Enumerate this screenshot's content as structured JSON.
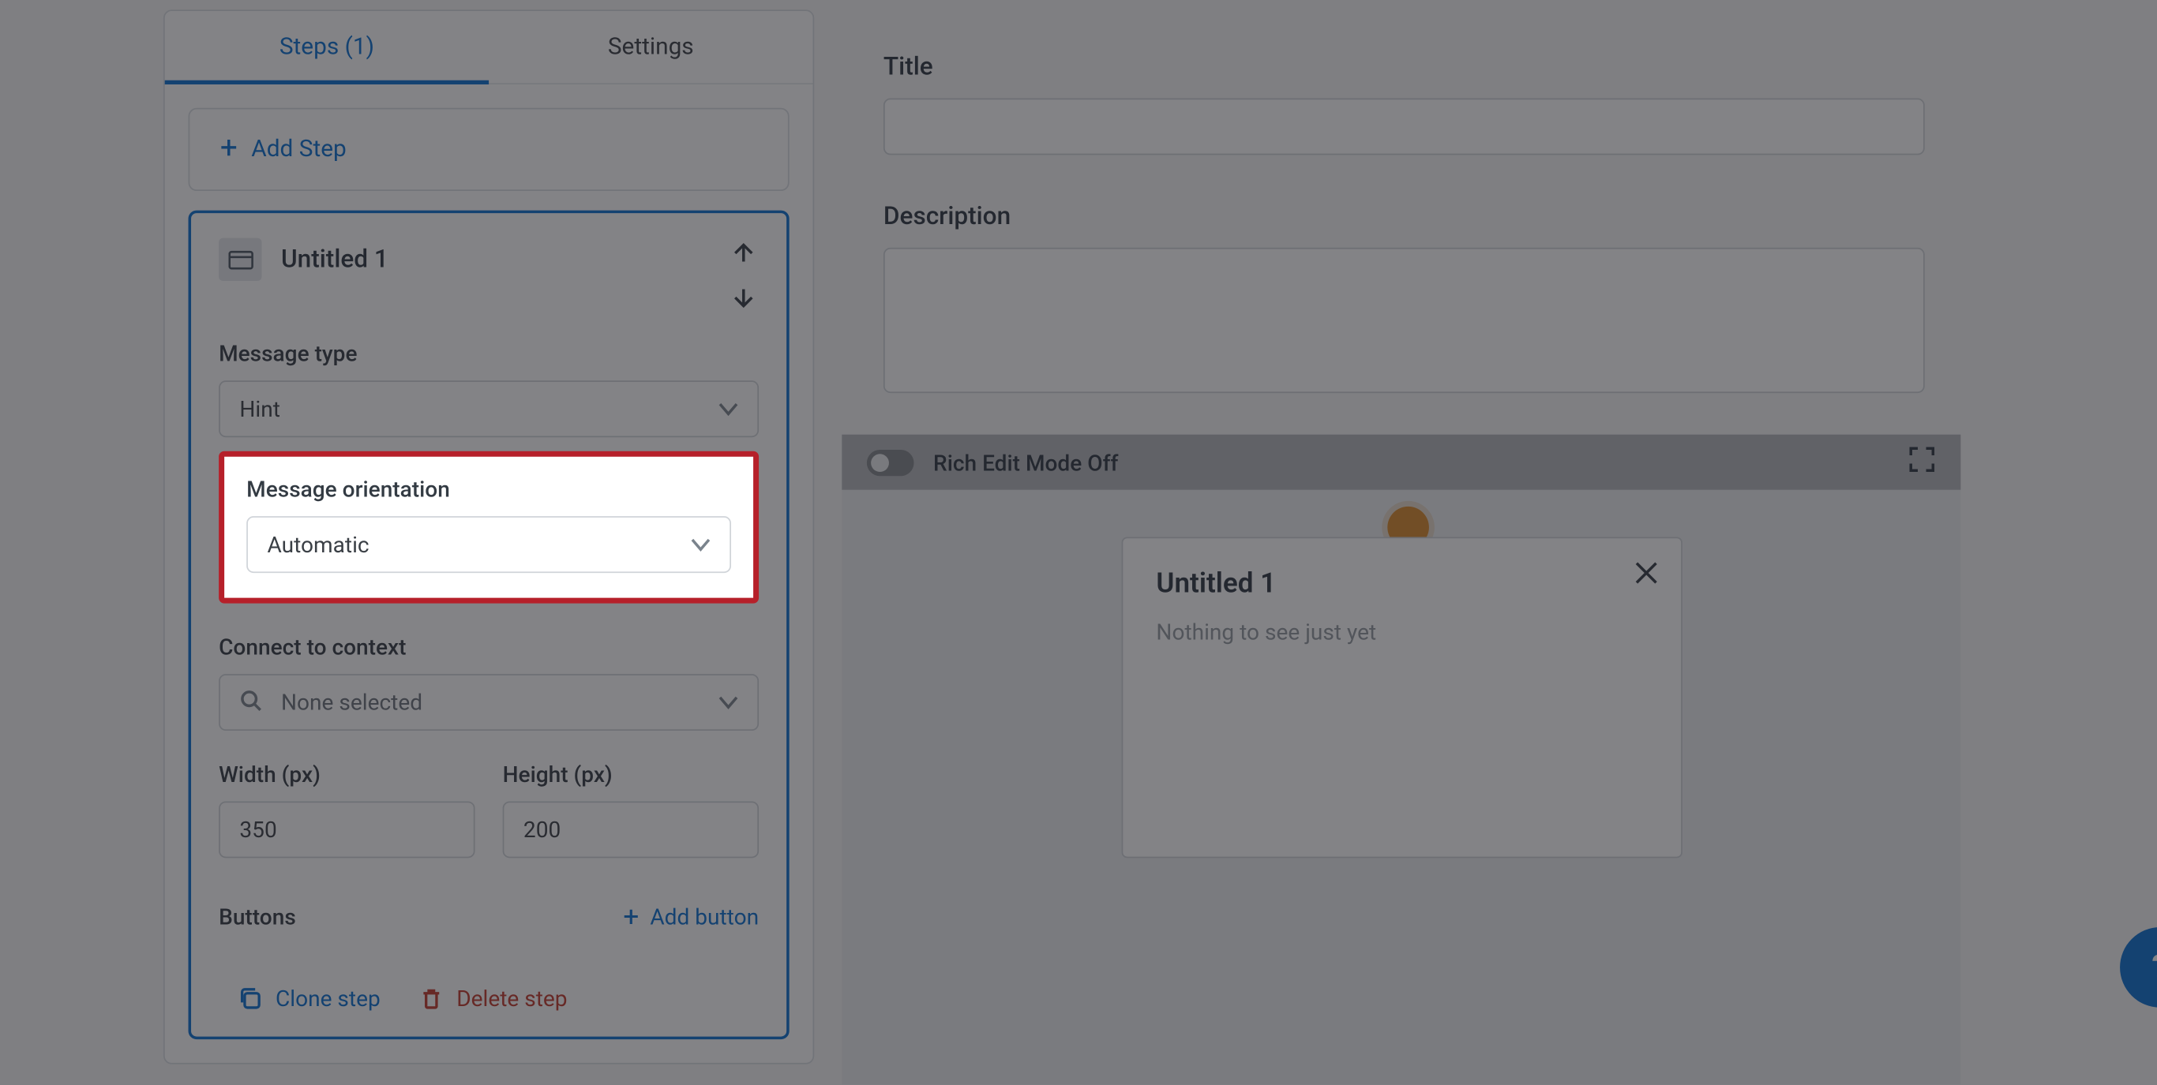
{
  "tabs": {
    "steps": "Steps (1)",
    "settings": "Settings"
  },
  "addStep": "Add Step",
  "step": {
    "title": "Untitled 1",
    "messageTypeLabel": "Message type",
    "messageTypeValue": "Hint",
    "orientationLabel": "Message orientation",
    "orientationValue": "Automatic",
    "connectLabel": "Connect to context",
    "connectValue": "None selected",
    "widthLabel": "Width (px)",
    "widthValue": "350",
    "heightLabel": "Height (px)",
    "heightValue": "200",
    "buttonsLabel": "Buttons",
    "addButton": "Add button",
    "clone": "Clone step",
    "delete": "Delete step"
  },
  "right": {
    "titleLabel": "Title",
    "descLabel": "Description",
    "richEdit": "Rich Edit Mode Off"
  },
  "preview": {
    "title": "Untitled 1",
    "body": "Nothing to see just yet"
  },
  "help": "?"
}
